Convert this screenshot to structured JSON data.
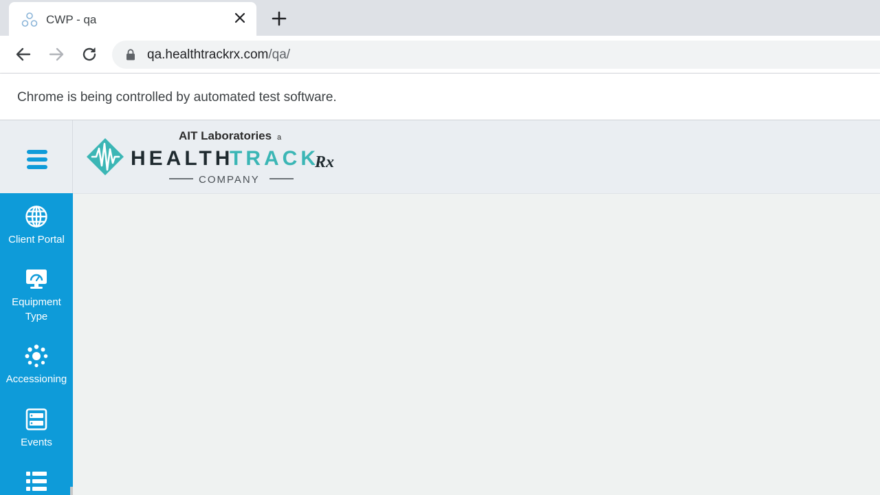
{
  "browser": {
    "tab_title": "CWP - qa",
    "url_host": "qa.healthtrackrx.com",
    "url_path": "/qa/",
    "infobar_text": "Chrome is being controlled by automated test software."
  },
  "logo": {
    "top_text": "AIT Laboratories",
    "top_suffix": "a",
    "brand_dark": "HEALTH",
    "brand_accent": "TRACK",
    "brand_rx": "Rx",
    "bottom_text": "COMPANY"
  },
  "sidebar": {
    "items": [
      {
        "label": "Client Portal",
        "icon": "globe-icon"
      },
      {
        "label": "Equipment Type",
        "icon": "monitor-gauge-icon"
      },
      {
        "label": "Accessioning",
        "icon": "spinner-icon"
      },
      {
        "label": "Events",
        "icon": "server-list-icon"
      },
      {
        "label": "",
        "icon": "list-icon"
      }
    ]
  },
  "colors": {
    "sidebar": "#0e9bd9",
    "brand_teal": "#3bb6b5",
    "brand_dark": "#1f2a2f"
  }
}
